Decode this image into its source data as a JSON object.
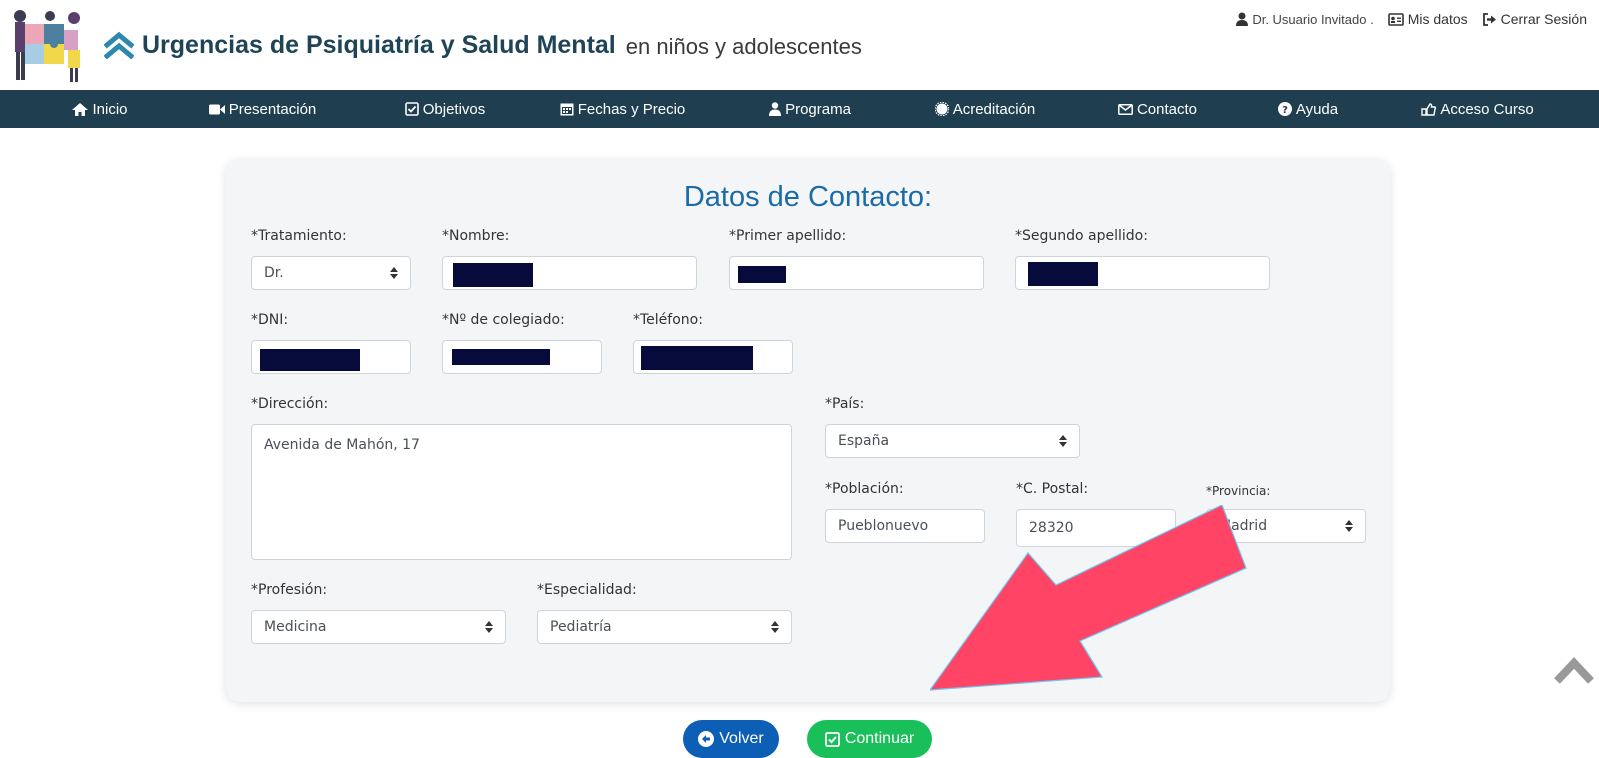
{
  "header": {
    "title_main": "Urgencias de Psiquiatría y Salud Mental",
    "title_sub": "en niños y adolescentes",
    "user_label": "Dr. Usuario Invitado .",
    "my_data_label": "Mis datos",
    "logout_label": "Cerrar Sesión"
  },
  "nav": {
    "items": [
      {
        "label": "Inicio",
        "icon": "home-icon"
      },
      {
        "label": "Presentación",
        "icon": "video-camera-icon"
      },
      {
        "label": "Objetivos",
        "icon": "checkbox-icon"
      },
      {
        "label": "Fechas y Precio",
        "icon": "calendar-icon"
      },
      {
        "label": "Programa",
        "icon": "user-doctor-icon"
      },
      {
        "label": "Acreditación",
        "icon": "certificate-icon"
      },
      {
        "label": "Contacto",
        "icon": "envelope-icon"
      },
      {
        "label": "Ayuda",
        "icon": "question-circle-icon"
      },
      {
        "label": "Acceso Curso",
        "icon": "hand-pointer-icon"
      }
    ]
  },
  "form": {
    "title": "Datos de Contacto:",
    "tratamiento": {
      "label": "*Tratamiento:",
      "value": "Dr."
    },
    "nombre": {
      "label": "*Nombre:"
    },
    "primer_apellido": {
      "label": "*Primer apellido:"
    },
    "segundo_apellido": {
      "label": "*Segundo apellido:"
    },
    "dni": {
      "label": "*DNI:"
    },
    "colegiado": {
      "label": "*Nº de colegiado:"
    },
    "telefono": {
      "label": "*Teléfono:"
    },
    "direccion": {
      "label": "*Dirección:",
      "value": "Avenida de Mahón, 17"
    },
    "pais": {
      "label": "*País:",
      "value": "España"
    },
    "poblacion": {
      "label": "*Población:",
      "value": "Pueblonuevo"
    },
    "postal": {
      "label": "*C. Postal:",
      "value": "28320"
    },
    "provincia": {
      "label": "*Provincia:",
      "value": "Madrid"
    },
    "profesion": {
      "label": "*Profesión:",
      "value": "Medicina"
    },
    "especialidad": {
      "label": "*Especialidad:",
      "value": "Pediatría"
    }
  },
  "buttons": {
    "back_label": "Volver",
    "continue_label": "Continuar"
  },
  "colors": {
    "nav_bg": "#1f3f50",
    "title_blue": "#1a6ba8",
    "back_btn": "#0c5fb5",
    "continue_btn": "#19c05a",
    "annotation_arrow": "#ff4466"
  }
}
